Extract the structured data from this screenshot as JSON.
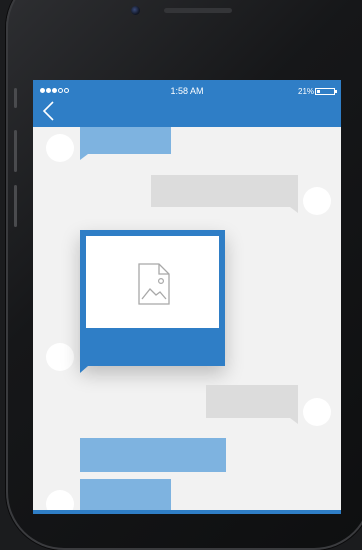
{
  "status_bar": {
    "signal_dots": [
      "full",
      "full",
      "full",
      "empty",
      "empty"
    ],
    "time": "1:58 AM",
    "battery_percent": "21%",
    "battery_level": 0.21
  },
  "header": {
    "back_icon": "chevron-left-icon"
  },
  "colors": {
    "accent": "#2f7ec6",
    "incoming_bubble": "#7eb3e0",
    "outgoing_bubble": "#dcdcdc",
    "chat_background": "#f2f2f2"
  },
  "message_thread": {
    "attachment": {
      "type": "image",
      "icon": "image-file-icon"
    }
  }
}
